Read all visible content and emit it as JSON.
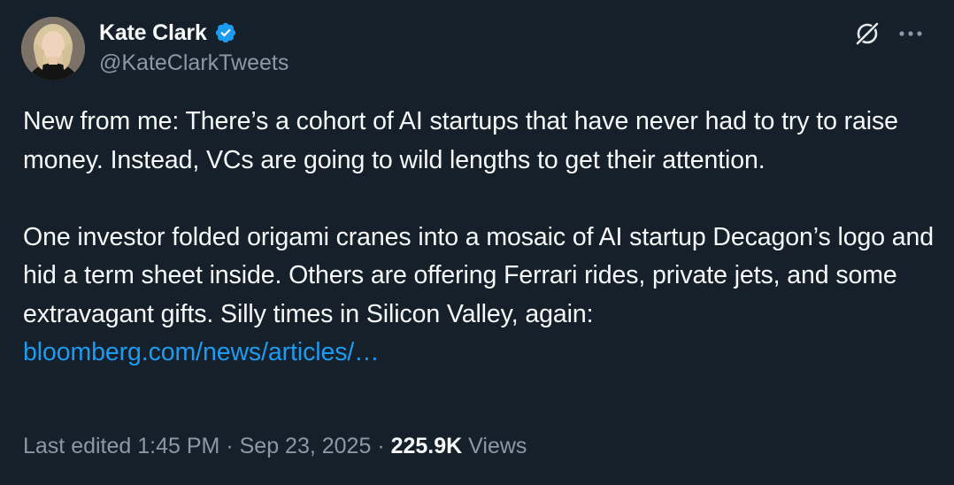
{
  "author": {
    "display_name": "Kate Clark",
    "handle": "@KateClarkTweets",
    "verified": true
  },
  "tweet": {
    "paragraph_1": "New from me: There’s a cohort of AI startups that have never had to try to raise money. Instead, VCs are going to wild lengths to get their attention.",
    "paragraph_2_line_1": "One investor folded origami cranes into a mosaic of AI startup Decagon’s logo and hid a term sheet inside. Others are offering Ferrari rides, private jets, and some extravagant gifts. Silly times in Silicon Valley, again:",
    "link_text": "bloomberg.com/news/articles/…"
  },
  "meta": {
    "edited_label": "Last edited 1:45 PM",
    "separator": "·",
    "date": "Sep 23, 2025",
    "views_count": "225.9K",
    "views_label": "Views"
  },
  "icons": {
    "verified": "verified-badge-icon",
    "grok": "grok-icon",
    "more": "more-icon"
  },
  "colors": {
    "background": "#15202b",
    "text_primary": "#f7f9f9",
    "text_secondary": "#8b98a5",
    "link": "#1d9bf0",
    "verified": "#1d9bf0"
  }
}
